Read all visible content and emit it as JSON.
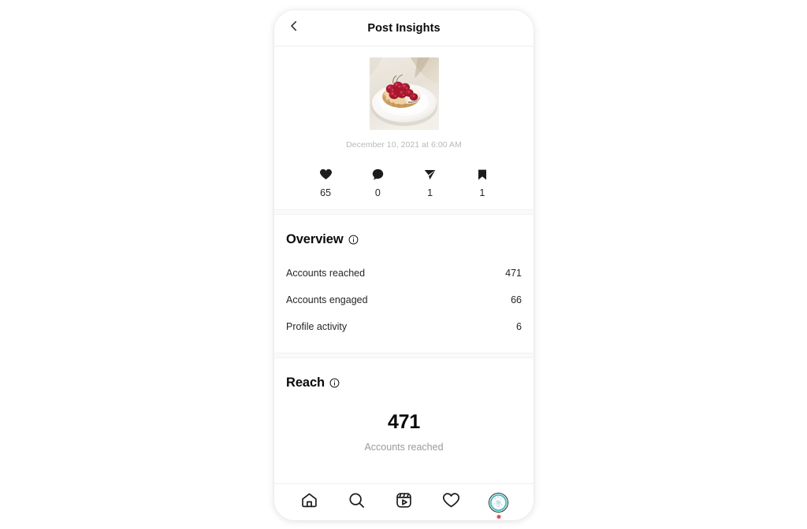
{
  "header": {
    "back_icon": "chevron-left-icon",
    "title": "Post Insights"
  },
  "post": {
    "thumbnail_alt": "raspberry-tart-on-white-plate",
    "date": "December 10, 2021 at 6:00 AM",
    "stats": [
      {
        "icon": "heart-icon",
        "name": "likes",
        "value": "65"
      },
      {
        "icon": "comment-icon",
        "name": "comments",
        "value": "0"
      },
      {
        "icon": "share-icon",
        "name": "shares",
        "value": "1"
      },
      {
        "icon": "bookmark-icon",
        "name": "saves",
        "value": "1"
      }
    ]
  },
  "overview": {
    "title": "Overview",
    "info_icon": "info-icon",
    "rows": [
      {
        "label": "Accounts reached",
        "value": "471"
      },
      {
        "label": "Accounts engaged",
        "value": "66"
      },
      {
        "label": "Profile activity",
        "value": "6"
      }
    ]
  },
  "reach": {
    "title": "Reach",
    "info_icon": "info-icon",
    "big_value": "471",
    "caption": "Accounts reached"
  },
  "navbar": {
    "items": [
      {
        "name": "nav-home",
        "icon": "home-icon"
      },
      {
        "name": "nav-search",
        "icon": "search-icon"
      },
      {
        "name": "nav-reels",
        "icon": "reels-icon"
      },
      {
        "name": "nav-activity",
        "icon": "heart-outline-icon"
      },
      {
        "name": "nav-profile",
        "icon": "avatar-donut-icon",
        "badge": true
      }
    ]
  },
  "colors": {
    "text_primary": "#0a0a0a",
    "text_secondary": "#262626",
    "text_muted": "#9a9a9a",
    "date_muted": "#b9b9b9",
    "divider": "#efefef",
    "band": "#fafafa",
    "badge": "#ed4956",
    "page_bg": "#ffffff"
  }
}
